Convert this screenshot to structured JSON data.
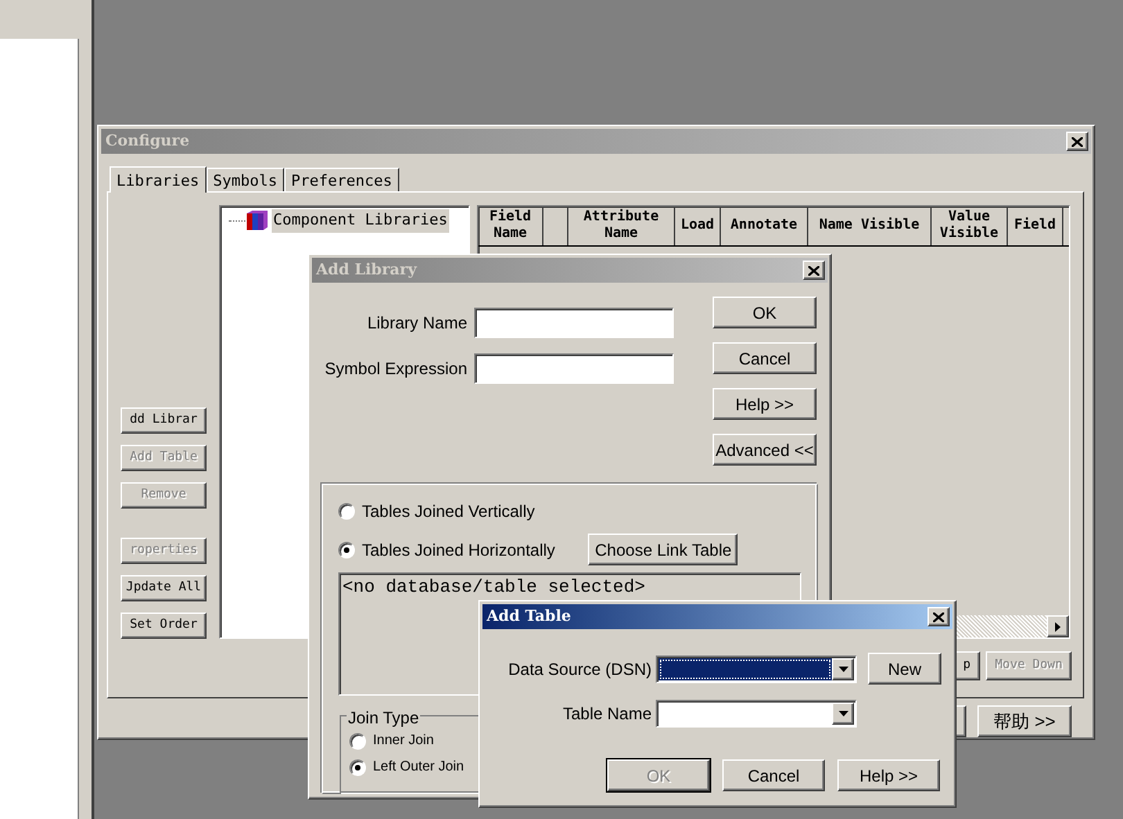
{
  "configure": {
    "title": "Configure",
    "active": false,
    "tabs": [
      {
        "label": "Libraries",
        "selected": true
      },
      {
        "label": "Symbols",
        "selected": false
      },
      {
        "label": "Preferences",
        "selected": false
      }
    ],
    "tree": [
      {
        "label": "Component Libraries",
        "selected": true
      }
    ],
    "side_buttons": [
      {
        "label": "dd Librar",
        "disabled": false
      },
      {
        "label": "Add Table",
        "disabled": true
      },
      {
        "label": "Remove",
        "disabled": true
      },
      {
        "label": "roperties",
        "disabled": true
      },
      {
        "label": "Jpdate All",
        "disabled": false
      },
      {
        "label": "Set Order",
        "disabled": false
      }
    ],
    "columns": [
      {
        "kind": "label",
        "label": "Field Name"
      },
      {
        "kind": "blank"
      },
      {
        "kind": "label",
        "label": "Attribute Name"
      },
      {
        "kind": "label",
        "label": "Load"
      },
      {
        "kind": "label",
        "label": "Annotate"
      },
      {
        "kind": "label",
        "label": "Name Visible"
      },
      {
        "kind": "label",
        "label": "Value Visible"
      },
      {
        "kind": "label",
        "label": "Field"
      }
    ],
    "move_buttons": [
      {
        "label": "p",
        "disabled": false
      },
      {
        "label": "Move Down",
        "disabled": true
      }
    ],
    "footer_buttons": [
      {
        "kind": "hidden"
      },
      {
        "kind": "label",
        "label": "帮助 >>"
      }
    ]
  },
  "add_library": {
    "title": "Add Library",
    "active": false,
    "fields": [
      {
        "label": "Library Name"
      },
      {
        "label": "Symbol Expression"
      }
    ],
    "buttons": [
      "OK",
      "Cancel",
      "Help >>",
      "Advanced <<"
    ],
    "join_options": [
      {
        "label": "Tables Joined Vertically",
        "selected": false
      },
      {
        "label": "Tables Joined Horizontally",
        "selected": true
      }
    ],
    "link_button": "Choose Link Table",
    "table_text": "<no database/table selected>",
    "join_type": {
      "title": "Join Type",
      "options": [
        {
          "label": "Inner Join",
          "selected": false
        },
        {
          "label": "Left Outer Join",
          "selected": true
        }
      ]
    }
  },
  "add_table": {
    "title": "Add Table",
    "active": true,
    "fields": [
      {
        "label": "Data Source (DSN)",
        "selected": true
      },
      {
        "label": "Table Name",
        "selected": false
      }
    ],
    "new_button": "New",
    "buttons": [
      {
        "label": "OK",
        "disabled": true,
        "default": true
      },
      {
        "label": "Cancel",
        "disabled": false,
        "default": false
      },
      {
        "label": "Help >>",
        "disabled": false,
        "default": false
      }
    ]
  }
}
